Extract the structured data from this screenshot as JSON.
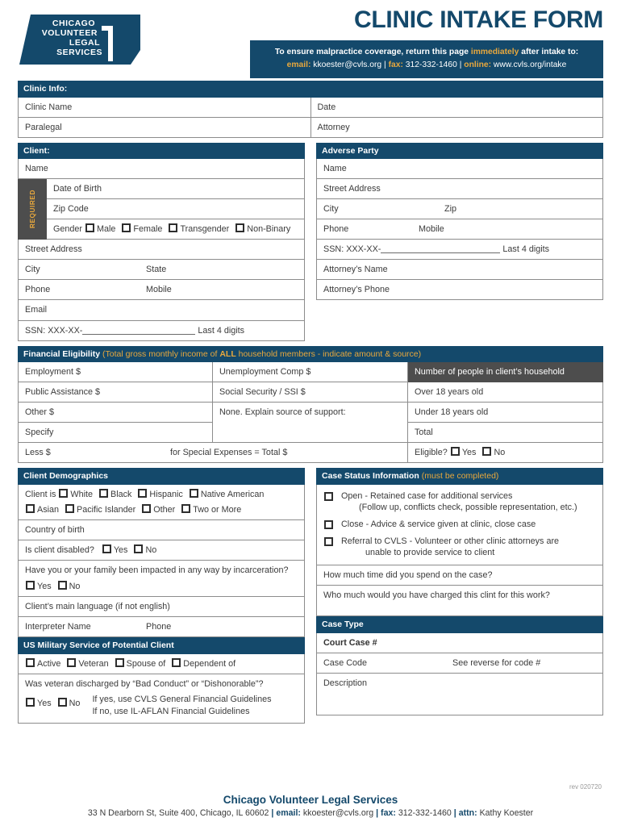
{
  "header": {
    "title": "CLINIC INTAKE FORM",
    "logo_lines": [
      "CHICAGO",
      "VOLUNTEER",
      "LEGAL",
      "SERVICES"
    ],
    "notice_line1_a": "To ensure malpractice coverage, return this page ",
    "notice_line1_b": "immediately",
    "notice_line1_c": " after intake to:",
    "notice_email_label": "email:",
    "notice_email_value": " kkoester@cvls.org ",
    "notice_sep1": "| ",
    "notice_fax_label": "fax:",
    "notice_fax_value": " 312-332-1460 ",
    "notice_sep2": "| ",
    "notice_online_label": "online:",
    "notice_online_value": " www.cvls.org/intake"
  },
  "clinic_info": {
    "bar": "Clinic Info:",
    "clinic_name": "Clinic Name",
    "date": "Date",
    "paralegal": "Paralegal",
    "attorney": "Attorney"
  },
  "client": {
    "bar": "Client:",
    "name": "Name",
    "required_tab": "REQUIRED",
    "date_of_birth": "Date of Birth",
    "zip_code": "Zip Code",
    "gender_label": "Gender",
    "gender_options": [
      "Male",
      "Female",
      "Transgender",
      "Non-Binary"
    ],
    "street_address": "Street Address",
    "city": "City",
    "state": "State",
    "phone": "Phone",
    "mobile": "Mobile",
    "email": "Email",
    "ssn_prefix": "SSN: XXX-XX-",
    "ssn_suffix": "Last 4 digits"
  },
  "adverse_party": {
    "bar": "Adverse Party",
    "name": "Name",
    "street_address": "Street Address",
    "city": "City",
    "zip": "Zip",
    "phone": "Phone",
    "mobile": "Mobile",
    "ssn_prefix": "SSN: XXX-XX-",
    "ssn_suffix": "Last 4 digits",
    "attorney_name": "Attorney’s Name",
    "attorney_phone": "Attorney’s Phone"
  },
  "financial": {
    "bar_title": "Financial Eligibility",
    "bar_note_a": " (Total gross monthly income of ",
    "bar_note_all": "ALL",
    "bar_note_b": " household members - indicate amount & source)",
    "employment": "Employment $",
    "unemployment": "Unemployment Comp $",
    "household_header": "Number of people in client’s household",
    "public_assistance": "Public Assistance $",
    "social_security": "Social Security / SSI $",
    "over_18": "Over 18 years old",
    "other": "Other $",
    "none_explain": "None. Explain source of support:",
    "under_18": "Under 18 years old",
    "specify": "Specify",
    "total": "Total",
    "less": "Less $",
    "special_expenses": "for Special Expenses = Total $",
    "eligible_label": "Eligible?",
    "eligible_options": [
      "Yes",
      "No"
    ]
  },
  "demographics": {
    "bar": "Client Demographics",
    "client_is_label": "Client is",
    "race_row1": [
      "White",
      "Black",
      "Hispanic",
      "Native American"
    ],
    "race_row2": [
      "Asian",
      "Pacific Islander",
      "Other",
      "Two or More"
    ],
    "country_of_birth": "Country of birth",
    "disabled_label": "Is client disabled?",
    "disabled_options": [
      "Yes",
      "No"
    ],
    "incarceration_question": "Have you or your family been impacted in any way by incarceration?",
    "incarceration_options": [
      "Yes",
      "No"
    ],
    "main_language": "Client’s main language (if not english)",
    "interpreter_name": "Interpreter Name",
    "interpreter_phone": "Phone"
  },
  "military": {
    "bar": "US Military Service of Potential Client",
    "options": [
      "Active",
      "Veteran",
      "Spouse of",
      "Dependent of"
    ],
    "discharge_question": "Was veteran discharged by “Bad Conduct” or “Dishonorable”?",
    "discharge_options": [
      "Yes",
      "No"
    ],
    "guideline_yes": "If yes, use CVLS General Financial Guidelines",
    "guideline_no": "If no, use IL-AFLAN Financial Guidelines"
  },
  "case_status": {
    "bar_title": "Case Status Information",
    "bar_note": " (must be completed)",
    "open_line1": "Open - Retained case for additional services",
    "open_line2": "(Follow up, conflicts check, possible representation, etc.)",
    "close_line": "Close - Advice & service given at clinic, close case",
    "referral_line1": "Referral to CVLS -  Volunteer or other clinic attorneys are",
    "referral_line2": "unable to provide service to client",
    "time_spent": "How much time did you spend on the case?",
    "charge_amount": "Who much would you have charged this clint for this work?"
  },
  "case_type": {
    "bar": "Case Type",
    "court_case": "Court Case #",
    "case_code": "Case Code",
    "code_note": "See reverse for code #",
    "description": "Description"
  },
  "footer": {
    "rev": "rev 020720",
    "org": "Chicago Volunteer Legal Services",
    "addr_a": "33 N Dearborn St, Suite 400, Chicago, IL 60602 ",
    "sep1": "| ",
    "email_label": "email:",
    "email_value": " kkoester@cvls.org ",
    "sep2": "| ",
    "fax_label": "fax:",
    "fax_value": " 312-332-1460 ",
    "sep3": "| ",
    "attn_label": "attn:",
    "attn_value": " Kathy Koester"
  },
  "colors": {
    "navy": "#14496b",
    "gold": "#e8a83d",
    "gray": "#4d4d4d",
    "border": "#8c8c8c"
  }
}
